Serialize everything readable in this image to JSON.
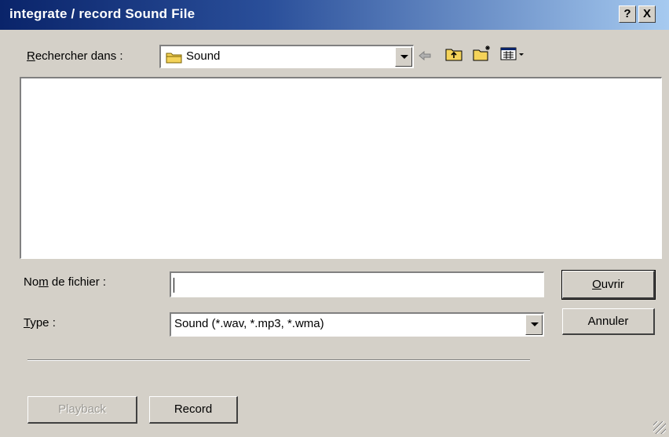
{
  "window": {
    "title": "integrate / record Sound File",
    "help_label": "?",
    "close_label": "X"
  },
  "look_in": {
    "label_underlined": "R",
    "label_rest": "echercher dans :",
    "folder": "Sound",
    "folder_icon": "folder-icon"
  },
  "toolbar": {
    "icons": [
      "back-arrow-icon",
      "up-folder-icon",
      "new-folder-icon",
      "view-menu-icon"
    ]
  },
  "file_list": {
    "items": []
  },
  "filename": {
    "label_pre": "No",
    "label_underlined": "m",
    "label_post": " de fichier :",
    "value": ""
  },
  "filetype": {
    "label_underlined": "T",
    "label_rest": "ype :",
    "selected": "Sound (*.wav, *.mp3, *.wma)"
  },
  "buttons": {
    "open_underlined": "O",
    "open_rest": "uvrir",
    "cancel": "Annuler",
    "playback": "Playback",
    "record": "Record"
  },
  "colors": {
    "title_start": "#0a246a",
    "title_end": "#a6caf0",
    "face": "#d4d0c8",
    "folder": "#f4d35a"
  }
}
